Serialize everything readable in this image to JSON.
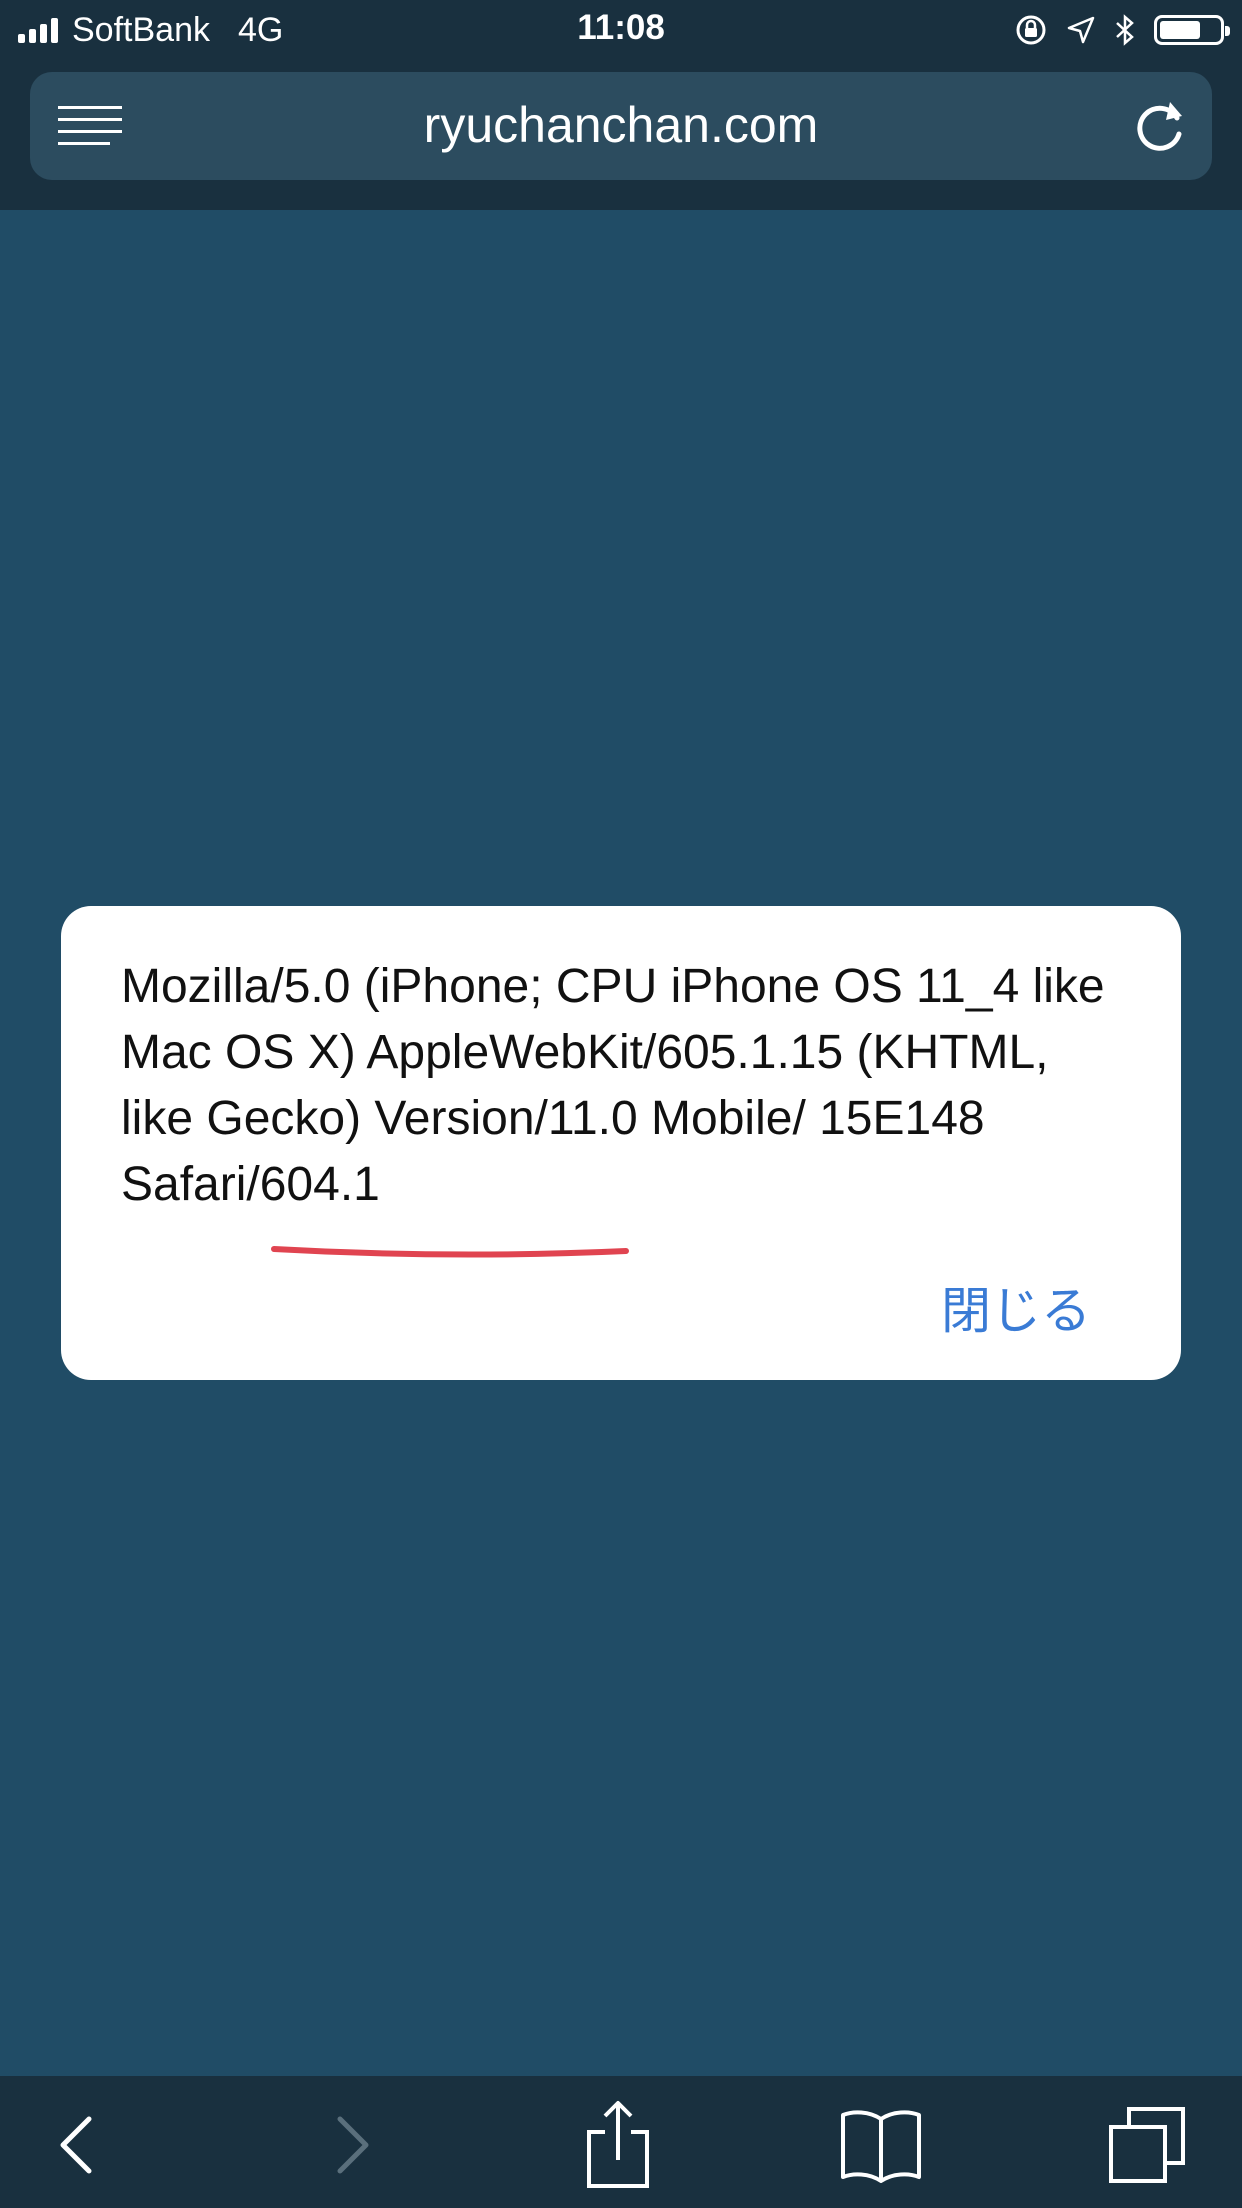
{
  "status_bar": {
    "carrier": "SoftBank",
    "network": "4G",
    "time": "11:08"
  },
  "browser": {
    "url": "ryuchanchan.com"
  },
  "alert": {
    "message": "Mozilla/5.0 (iPhone; CPU iPhone OS 11_4 like Mac OS X) AppleWebKit/605.1.15 (KHTML, like Gecko) Version/11.0 Mobile/ 15E148 Safari/604.1",
    "close_label": "閉じる"
  },
  "toolbar": {
    "icons": [
      "back-icon",
      "forward-icon",
      "share-icon",
      "bookmarks-icon",
      "tabs-icon"
    ]
  },
  "colors": {
    "background": "#204c66",
    "bar": "#19303f",
    "accent": "#3a7bd5",
    "highlight": "#e04450"
  }
}
